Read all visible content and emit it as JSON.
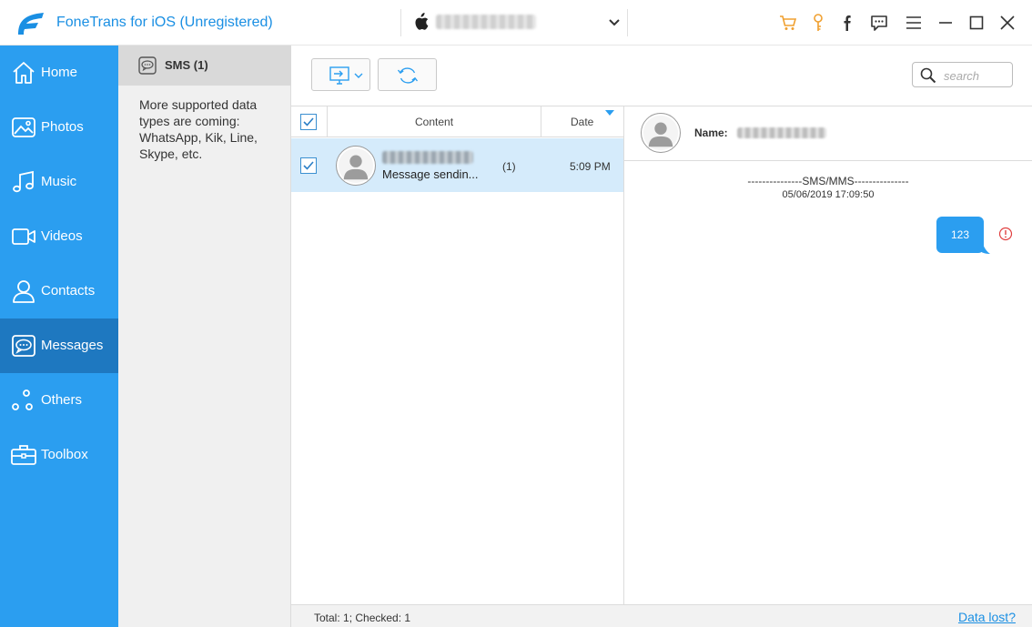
{
  "app": {
    "title": "FoneTrans for iOS (Unregistered)"
  },
  "colors": {
    "sidebar": "#2b9ef0",
    "sidebar_active": "#1e78c0",
    "accent": "#1a8fe3",
    "cart": "#f0a030",
    "error": "#e04040"
  },
  "titlebar": {
    "icons": [
      "cart-icon",
      "key-icon",
      "facebook-icon",
      "feedback-icon",
      "menu-icon",
      "minimize-icon",
      "maximize-icon",
      "close-icon"
    ]
  },
  "sidebar": {
    "items": [
      {
        "label": "Home",
        "icon": "home-icon"
      },
      {
        "label": "Photos",
        "icon": "photos-icon"
      },
      {
        "label": "Music",
        "icon": "music-icon"
      },
      {
        "label": "Videos",
        "icon": "video-icon"
      },
      {
        "label": "Contacts",
        "icon": "contacts-icon"
      },
      {
        "label": "Messages",
        "icon": "messages-icon",
        "active": true
      },
      {
        "label": "Others",
        "icon": "others-icon"
      },
      {
        "label": "Toolbox",
        "icon": "toolbox-icon"
      }
    ]
  },
  "category": {
    "header": "SMS (1)",
    "note": "More supported data types are coming: WhatsApp, Kik, Line, Skype, etc."
  },
  "search": {
    "placeholder": "search"
  },
  "list": {
    "columns": {
      "content": "Content",
      "date": "Date"
    },
    "rows": [
      {
        "preview": "Message sendin...",
        "count": "(1)",
        "time": "5:09 PM",
        "checked": true
      }
    ]
  },
  "detail": {
    "name_label": "Name:",
    "divider": "---------------SMS/MMS---------------",
    "date": "05/06/2019 17:09:50",
    "message": "123"
  },
  "status": {
    "text": "Total: 1; Checked: 1",
    "link": "Data lost?"
  }
}
